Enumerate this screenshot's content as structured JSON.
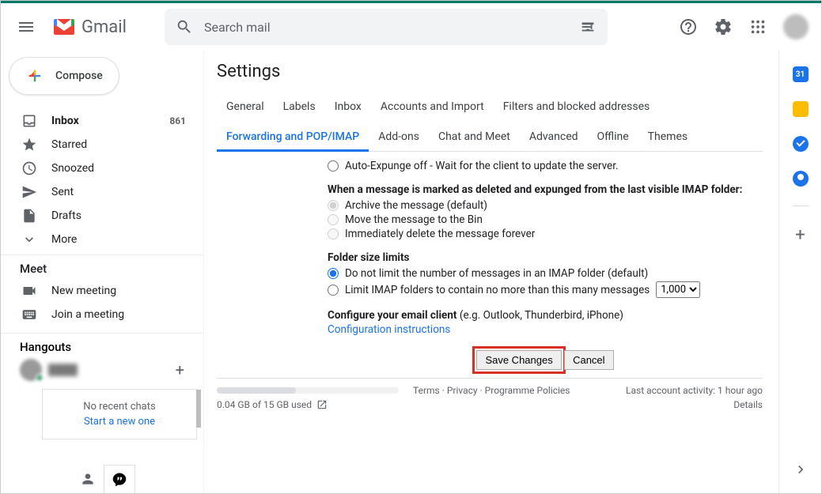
{
  "header": {
    "app_name": "Gmail",
    "search_placeholder": "Search mail"
  },
  "compose_label": "Compose",
  "sidebar": {
    "items": [
      {
        "label": "Inbox",
        "count": "861"
      },
      {
        "label": "Starred"
      },
      {
        "label": "Snoozed"
      },
      {
        "label": "Sent"
      },
      {
        "label": "Drafts"
      },
      {
        "label": "More"
      }
    ]
  },
  "meet": {
    "title": "Meet",
    "new_meeting": "New meeting",
    "join_meeting": "Join a meeting"
  },
  "hangouts": {
    "title": "Hangouts",
    "no_chats": "No recent chats",
    "start_new": "Start a new one"
  },
  "settings_title": "Settings",
  "tabs": {
    "row1": [
      "General",
      "Labels",
      "Inbox",
      "Accounts and Import",
      "Filters and blocked addresses"
    ],
    "row2": [
      "Forwarding and POP/IMAP",
      "Add-ons",
      "Chat and Meet",
      "Advanced",
      "Offline",
      "Themes"
    ]
  },
  "opts": {
    "auto_expunge_off": "Auto-Expunge off - Wait for the client to update the server.",
    "expunge_title": "When a message is marked as deleted and expunged from the last visible IMAP folder:",
    "archive": "Archive the message (default)",
    "bin": "Move the message to the Bin",
    "delete": "Immediately delete the message forever",
    "folder_title": "Folder size limits",
    "no_limit": "Do not limit the number of messages in an IMAP folder (default)",
    "limit_pre": "Limit IMAP folders to contain no more than this many messages",
    "limit_options": [
      "1,000"
    ],
    "config_title": "Configure your email client",
    "config_sub": "(e.g. Outlook, Thunderbird, iPhone)",
    "config_link": "Configuration instructions"
  },
  "buttons": {
    "save": "Save Changes",
    "cancel": "Cancel"
  },
  "footer": {
    "links": "Terms · Privacy · Programme Policies",
    "activity": "Last account activity: 1 hour ago",
    "details": "Details",
    "storage": "0.04 GB of 15 GB used"
  },
  "right_panel": {
    "cal_day": "31"
  }
}
